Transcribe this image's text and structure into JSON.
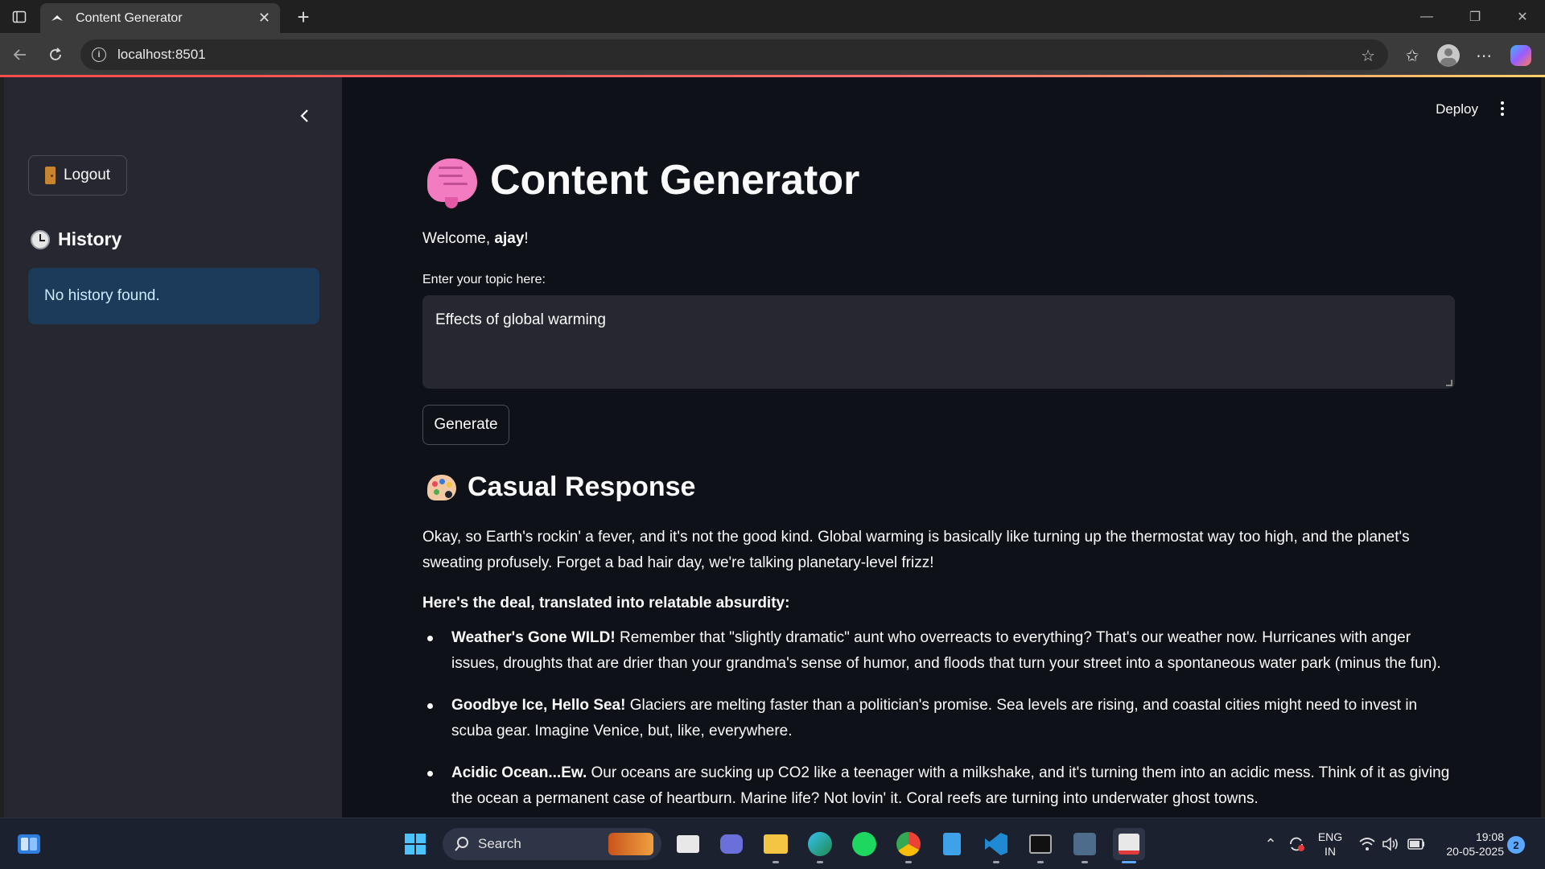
{
  "browser": {
    "tab_title": "Content Generator",
    "url": "localhost:8501"
  },
  "sidebar": {
    "logout_label": "Logout",
    "history_title": "History",
    "history_empty": "No history found."
  },
  "header": {
    "deploy_label": "Deploy"
  },
  "main": {
    "title": "Content Generator",
    "welcome_prefix": "Welcome, ",
    "username": "ajay",
    "welcome_suffix": "!",
    "topic_label": "Enter your topic here:",
    "topic_value": "Effects of global warming",
    "generate_label": "Generate",
    "response_title": "Casual Response",
    "intro": "Okay, so Earth's rockin' a fever, and it's not the good kind. Global warming is basically like turning up the thermostat way too high, and the planet's sweating profusely. Forget a bad hair day, we're talking planetary-level frizz!",
    "deal_heading": "Here's the deal, translated into relatable absurdity:",
    "points": [
      {
        "bold": "Weather's Gone WILD!",
        "text": " Remember that \"slightly dramatic\" aunt who overreacts to everything? That's our weather now. Hurricanes with anger issues, droughts that are drier than your grandma's sense of humor, and floods that turn your street into a spontaneous water park (minus the fun)."
      },
      {
        "bold": "Goodbye Ice, Hello Sea!",
        "text": " Glaciers are melting faster than a politician's promise. Sea levels are rising, and coastal cities might need to invest in scuba gear. Imagine Venice, but, like, everywhere."
      },
      {
        "bold": "Acidic Ocean...Ew.",
        "text": " Our oceans are sucking up CO2 like a teenager with a milkshake, and it's turning them into an acidic mess. Think of it as giving the ocean a permanent case of heartburn. Marine life? Not lovin' it. Coral reefs are turning into underwater ghost towns."
      }
    ]
  },
  "taskbar": {
    "search_label": "Search",
    "lang_1": "ENG",
    "lang_2": "IN",
    "time": "19:08",
    "date": "20-05-2025",
    "notifications": "2"
  }
}
